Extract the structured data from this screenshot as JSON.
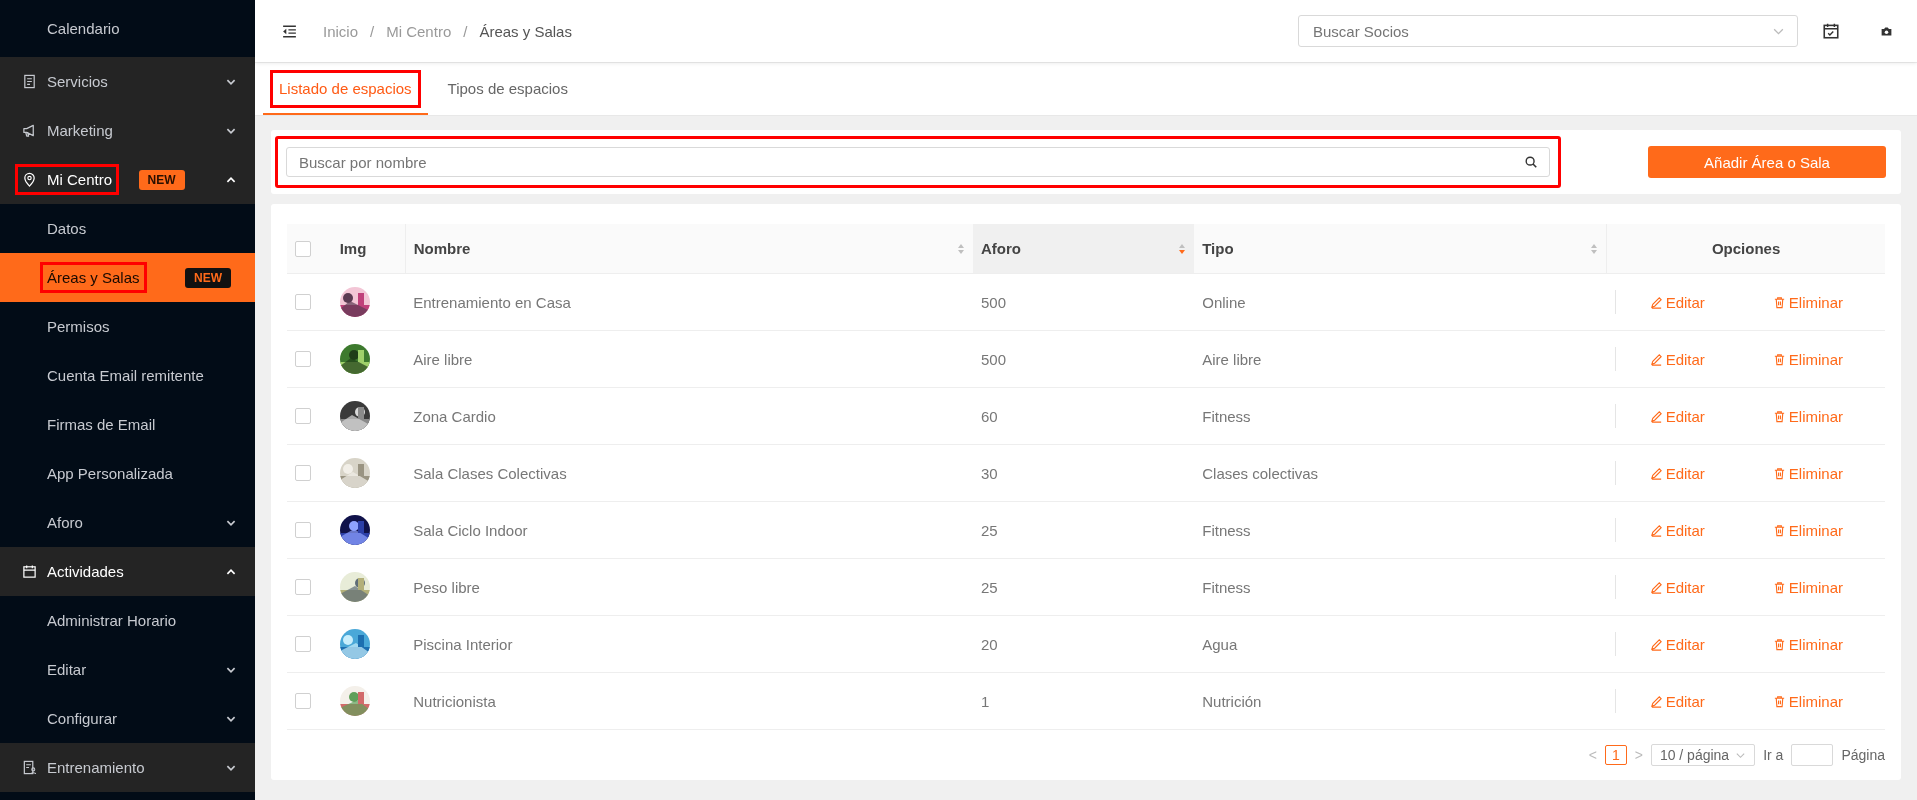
{
  "sidebar": {
    "items": [
      {
        "kind": "sub",
        "label": "Calendario",
        "selected": false
      },
      {
        "kind": "group",
        "label": "Servicios",
        "expanded": false,
        "selected": false
      },
      {
        "kind": "group",
        "label": "Marketing",
        "expanded": false,
        "selected": false
      },
      {
        "kind": "group",
        "label": "Mi Centro",
        "expanded": true,
        "selected": false,
        "highlighted": true,
        "badge": "NEW",
        "children": [
          {
            "kind": "sub",
            "label": "Datos",
            "selected": false
          },
          {
            "kind": "sub",
            "label": "Áreas y Salas",
            "selected": true,
            "highlighted": true,
            "badge": "NEW"
          },
          {
            "kind": "sub",
            "label": "Permisos",
            "selected": false
          },
          {
            "kind": "sub",
            "label": "Cuenta Email remitente",
            "selected": false
          },
          {
            "kind": "sub",
            "label": "Firmas de Email",
            "selected": false
          },
          {
            "kind": "sub",
            "label": "App Personalizada",
            "selected": false
          },
          {
            "kind": "sub",
            "label": "Aforo",
            "expanded": false,
            "selected": false
          }
        ]
      },
      {
        "kind": "group",
        "label": "Actividades",
        "expanded": true,
        "selected": false,
        "children": [
          {
            "kind": "sub",
            "label": "Administrar Horario",
            "selected": false
          },
          {
            "kind": "sub",
            "label": "Editar",
            "expanded": false,
            "selected": false
          },
          {
            "kind": "sub",
            "label": "Configurar",
            "expanded": false,
            "selected": false
          }
        ]
      },
      {
        "kind": "group",
        "label": "Entrenamiento",
        "expanded": false,
        "selected": false
      }
    ]
  },
  "breadcrumb": {
    "items": [
      "Inicio",
      "Mi Centro",
      "Áreas y Salas"
    ],
    "separator": "/"
  },
  "member_search": {
    "placeholder": "Buscar Socios"
  },
  "tabs": [
    {
      "label": "Listado de espacios",
      "selected": true,
      "highlighted": true
    },
    {
      "label": "Tipos de espacios",
      "selected": false,
      "highlighted": false
    }
  ],
  "name_search": {
    "placeholder": "Buscar por nombre",
    "highlighted": true
  },
  "add_button": "Añadir Área o Sala",
  "table": {
    "columns": [
      {
        "label": "Img"
      },
      {
        "label": "Nombre",
        "sortable": true,
        "sorted_descending": false
      },
      {
        "label": "Aforo",
        "sortable": true,
        "sorted_descending": true
      },
      {
        "label": "Tipo",
        "sortable": true,
        "sorted_descending": false
      },
      {
        "label": "Opciones"
      }
    ],
    "all_checked": false,
    "rows": [
      {
        "name": "Entrenamiento en Casa",
        "aforo": "500",
        "tipo": "Online",
        "checked": false,
        "edit": "Editar",
        "delete": "Eliminar"
      },
      {
        "name": "Aire libre",
        "aforo": "500",
        "tipo": "Aire libre",
        "checked": false,
        "edit": "Editar",
        "delete": "Eliminar"
      },
      {
        "name": "Zona Cardio",
        "aforo": "60",
        "tipo": "Fitness",
        "checked": false,
        "edit": "Editar",
        "delete": "Eliminar"
      },
      {
        "name": "Sala Clases Colectivas",
        "aforo": "30",
        "tipo": "Clases colectivas",
        "checked": false,
        "edit": "Editar",
        "delete": "Eliminar"
      },
      {
        "name": "Sala Ciclo Indoor",
        "aforo": "25",
        "tipo": "Fitness",
        "checked": false,
        "edit": "Editar",
        "delete": "Eliminar"
      },
      {
        "name": "Peso libre",
        "aforo": "25",
        "tipo": "Fitness",
        "checked": false,
        "edit": "Editar",
        "delete": "Eliminar"
      },
      {
        "name": "Piscina Interior",
        "aforo": "20",
        "tipo": "Agua",
        "checked": false,
        "edit": "Editar",
        "delete": "Eliminar"
      },
      {
        "name": "Nutricionista",
        "aforo": "1",
        "tipo": "Nutrición",
        "checked": false,
        "edit": "Editar",
        "delete": "Eliminar"
      }
    ]
  },
  "pagination": {
    "prev": "<",
    "pages": [
      {
        "label": "1",
        "selected": true
      }
    ],
    "next": ">",
    "page_size": "10 / página",
    "goto_label": "Ir a",
    "page_label": "Página"
  }
}
